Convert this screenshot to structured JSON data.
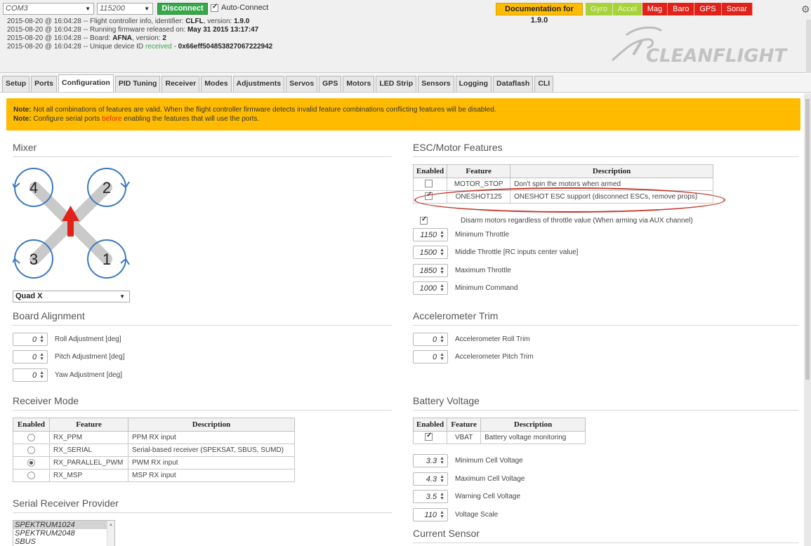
{
  "header": {
    "port": "COM3",
    "baud": "115200",
    "connect_label": "Disconnect",
    "auto_connect_label": "Auto-Connect",
    "docs_label": "Documentation for 1.9.0",
    "sensors": [
      {
        "name": "Gyro",
        "state": "ok"
      },
      {
        "name": "Accel",
        "state": "ok"
      },
      {
        "name": "Mag",
        "state": "bad"
      },
      {
        "name": "Baro",
        "state": "bad"
      },
      {
        "name": "GPS",
        "state": "bad"
      },
      {
        "name": "Sonar",
        "state": "bad"
      }
    ],
    "log": {
      "l1_prefix": "2015-08-20 @ 16:04:28 -- Flight controller info, identifier: ",
      "l1_id": "CLFL",
      "l1_mid": ", version: ",
      "l1_ver": "1.9.0",
      "l2_prefix": "2015-08-20 @ 16:04:28 -- Running firmware released on: ",
      "l2_date": "May 31 2015 13:17:47",
      "l3_prefix": "2015-08-20 @ 16:04:28 -- Board: ",
      "l3_board": "AFNA",
      "l3_mid": ", version: ",
      "l3_ver": "2",
      "l4_prefix": "2015-08-20 @ 16:04:28 -- Unique device ID ",
      "l4_received": "received",
      "l4_sep": " - ",
      "l4_uid": "0x66eff504853827067222942"
    },
    "logo_text": "CLEANFLIGHT"
  },
  "tabs": [
    "Setup",
    "Ports",
    "Configuration",
    "PID Tuning",
    "Receiver",
    "Modes",
    "Adjustments",
    "Servos",
    "GPS",
    "Motors",
    "LED Strip",
    "Sensors",
    "Logging",
    "Dataflash",
    "CLI"
  ],
  "note": {
    "n1_label": "Note:",
    "n1_text": " Not all combinations of features are valid. When the flight controller firmware detects invalid feature combinations conflicting features will be disabled.",
    "n2_label": "Note:",
    "n2_a": " Configure serial ports ",
    "n2_before": "before",
    "n2_b": " enabling the features that will use the ports."
  },
  "mixer": {
    "title": "Mixer",
    "motor_labels": [
      "4",
      "2",
      "3",
      "1"
    ],
    "selected": "Quad X"
  },
  "board_alignment": {
    "title": "Board Alignment",
    "rows": [
      {
        "value": "0",
        "label": "Roll Adjustment [deg]"
      },
      {
        "value": "0",
        "label": "Pitch Adjustment [deg]"
      },
      {
        "value": "0",
        "label": "Yaw Adjustment [deg]"
      }
    ]
  },
  "receiver_mode": {
    "title": "Receiver Mode",
    "headers": [
      "Enabled",
      "Feature",
      "Description"
    ],
    "rows": [
      {
        "enabled": false,
        "feature": "RX_PPM",
        "desc": "PPM RX input"
      },
      {
        "enabled": false,
        "feature": "RX_SERIAL",
        "desc": "Serial-based receiver (SPEKSAT, SBUS, SUMD)"
      },
      {
        "enabled": true,
        "feature": "RX_PARALLEL_PWM",
        "desc": "PWM RX input"
      },
      {
        "enabled": false,
        "feature": "RX_MSP",
        "desc": "MSP RX input"
      }
    ]
  },
  "serial_provider": {
    "title": "Serial Receiver Provider",
    "options": [
      "SPEKTRUM1024",
      "SPEKTRUM2048",
      "SBUS"
    ]
  },
  "esc": {
    "title": "ESC/Motor Features",
    "headers": [
      "Enabled",
      "Feature",
      "Description"
    ],
    "rows": [
      {
        "enabled": false,
        "feature": "MOTOR_STOP",
        "desc": "Don't spin the motors when armed"
      },
      {
        "enabled": true,
        "feature": "ONESHOT125",
        "desc": "ONESHOT ESC support (disconnect ESCs, remove props)"
      }
    ],
    "disarm_label": "Disarm motors regardless of throttle value (When arming via AUX channel)",
    "throttle": [
      {
        "value": "1150",
        "label": "Minimum Throttle"
      },
      {
        "value": "1500",
        "label": "Middle Throttle [RC inputs center value]"
      },
      {
        "value": "1850",
        "label": "Maximum Throttle"
      },
      {
        "value": "1000",
        "label": "Minimum Command"
      }
    ]
  },
  "acc_trim": {
    "title": "Accelerometer Trim",
    "rows": [
      {
        "value": "0",
        "label": "Accelerometer Roll Trim"
      },
      {
        "value": "0",
        "label": "Accelerometer Pitch Trim"
      }
    ]
  },
  "battery": {
    "title": "Battery Voltage",
    "headers": [
      "Enabled",
      "Feature",
      "Description"
    ],
    "row": {
      "enabled": true,
      "feature": "VBAT",
      "desc": "Battery voltage monitoring"
    },
    "rows": [
      {
        "value": "3.3",
        "label": "Minimum Cell Voltage"
      },
      {
        "value": "4.3",
        "label": "Maximum Cell Voltage"
      },
      {
        "value": "3.5",
        "label": "Warning Cell Voltage"
      },
      {
        "value": "110",
        "label": "Voltage Scale"
      }
    ]
  },
  "current_sensor": {
    "title": "Current Sensor"
  }
}
